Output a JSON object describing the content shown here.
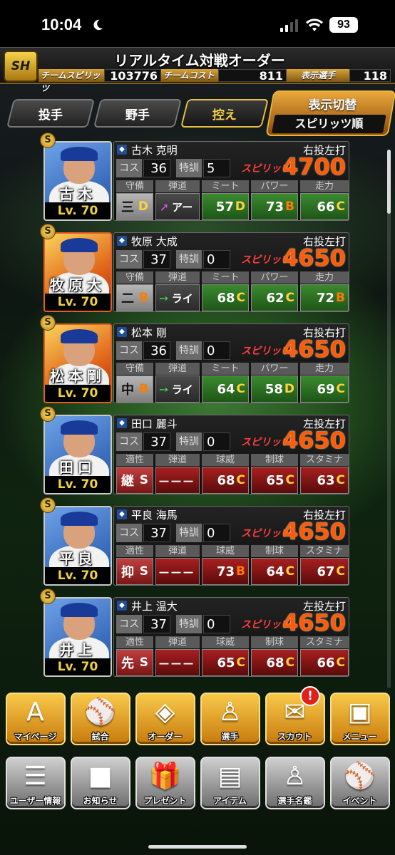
{
  "status": {
    "time": "10:04",
    "battery": "93"
  },
  "header": {
    "logo": "SH",
    "title": "リアルタイム対戦オーダー",
    "spirits_label": "チームスピリッツ",
    "spirits_value": "103776",
    "cost_label": "チームコスト",
    "cost_value": "811",
    "shown_label": "表示選手",
    "shown_value": "118"
  },
  "tabs": [
    "投手",
    "野手",
    "控え"
  ],
  "active_tab": "控え",
  "sort": {
    "label": "表示切替",
    "value": "スピリッツ順"
  },
  "labels": {
    "cost": "コス",
    "training": "特訓",
    "spirits": "スピリッツ",
    "fielder_headers": [
      "守備",
      "弾道",
      "ミート",
      "パワー",
      "走力"
    ],
    "pitcher_headers": [
      "適性",
      "弾道",
      "球威",
      "制球",
      "スタミナ"
    ]
  },
  "players": [
    {
      "card_name": "古木",
      "full_name": "古木 克明",
      "level": "Lv. 70",
      "hand": "右投左打",
      "cost": "36",
      "training": "5",
      "spirits": "4700",
      "type": "fielder",
      "pos": "三",
      "pos_grade": "D",
      "traj_icon": "up-right-arrow",
      "traj": "アー",
      "a": "57",
      "ag": "D",
      "b": "73",
      "bg": "B",
      "c": "66",
      "cg": "C",
      "team_icon": "baystars-icon"
    },
    {
      "card_name": "牧原大",
      "full_name": "牧原 大成",
      "level": "Lv. 70",
      "hand": "右投左打",
      "cost": "37",
      "training": "0",
      "spirits": "4650",
      "type": "fielder",
      "pos": "二",
      "pos_grade": "B",
      "traj_icon": "right-arrow",
      "traj": "ライ",
      "a": "68",
      "ag": "C",
      "b": "62",
      "bg": "C",
      "c": "72",
      "cg": "B",
      "team_icon": "hawks-icon"
    },
    {
      "card_name": "松本剛",
      "full_name": "松本 剛",
      "level": "Lv. 70",
      "hand": "右投右打",
      "cost": "36",
      "training": "0",
      "spirits": "4650",
      "type": "fielder",
      "pos": "中",
      "pos_grade": "B",
      "traj_icon": "right-arrow",
      "traj": "ライ",
      "a": "64",
      "ag": "C",
      "b": "58",
      "bg": "D",
      "c": "69",
      "cg": "C",
      "team_icon": "fighters-icon"
    },
    {
      "card_name": "田口",
      "full_name": "田口 麗斗",
      "level": "Lv. 70",
      "hand": "左投左打",
      "cost": "37",
      "training": "0",
      "spirits": "4650",
      "type": "pitcher",
      "pos": "継",
      "pos_grade": "S",
      "traj": "－－－",
      "a": "68",
      "ag": "C",
      "b": "65",
      "bg": "C",
      "c": "63",
      "cg": "C",
      "team_icon": "swallows-icon"
    },
    {
      "card_name": "平良",
      "full_name": "平良 海馬",
      "level": "Lv. 70",
      "hand": "右投左打",
      "cost": "37",
      "training": "0",
      "spirits": "4650",
      "type": "pitcher",
      "pos": "抑",
      "pos_grade": "S",
      "traj": "－－－",
      "a": "73",
      "ag": "B",
      "b": "64",
      "bg": "C",
      "c": "67",
      "cg": "C",
      "team_icon": "lions-icon"
    },
    {
      "card_name": "井上",
      "full_name": "井上 温大",
      "level": "Lv. 70",
      "hand": "左投左打",
      "cost": "37",
      "training": "0",
      "spirits": "4650",
      "type": "pitcher",
      "pos": "先",
      "pos_grade": "S",
      "traj": "－－－",
      "a": "65",
      "ag": "C",
      "b": "68",
      "bg": "C",
      "c": "66",
      "cg": "C",
      "team_icon": "giants-icon"
    }
  ],
  "nav_top": [
    {
      "label": "マイページ",
      "icon": "mypage-icon",
      "glyph": "A"
    },
    {
      "label": "試合",
      "icon": "stadium-icon",
      "glyph": "⚾"
    },
    {
      "label": "オーダー",
      "icon": "field-icon",
      "glyph": "◈"
    },
    {
      "label": "選手",
      "icon": "player-icon",
      "glyph": "♙"
    },
    {
      "label": "スカウト",
      "icon": "scout-icon",
      "glyph": "✉"
    },
    {
      "label": "メニュー",
      "icon": "menu-icon",
      "glyph": "▣"
    }
  ],
  "nav_bottom": [
    {
      "label": "ユーザー情報",
      "icon": "user-info-icon",
      "glyph": "☰"
    },
    {
      "label": "お知らせ",
      "icon": "news-icon",
      "glyph": "■"
    },
    {
      "label": "プレゼント",
      "icon": "present-icon",
      "glyph": "🎁"
    },
    {
      "label": "アイテム",
      "icon": "item-icon",
      "glyph": "▤"
    },
    {
      "label": "選手名鑑",
      "icon": "player-book-icon",
      "glyph": "♙"
    },
    {
      "label": "イベント",
      "icon": "event-icon",
      "glyph": "⚾"
    }
  ],
  "notification_badge": "!"
}
